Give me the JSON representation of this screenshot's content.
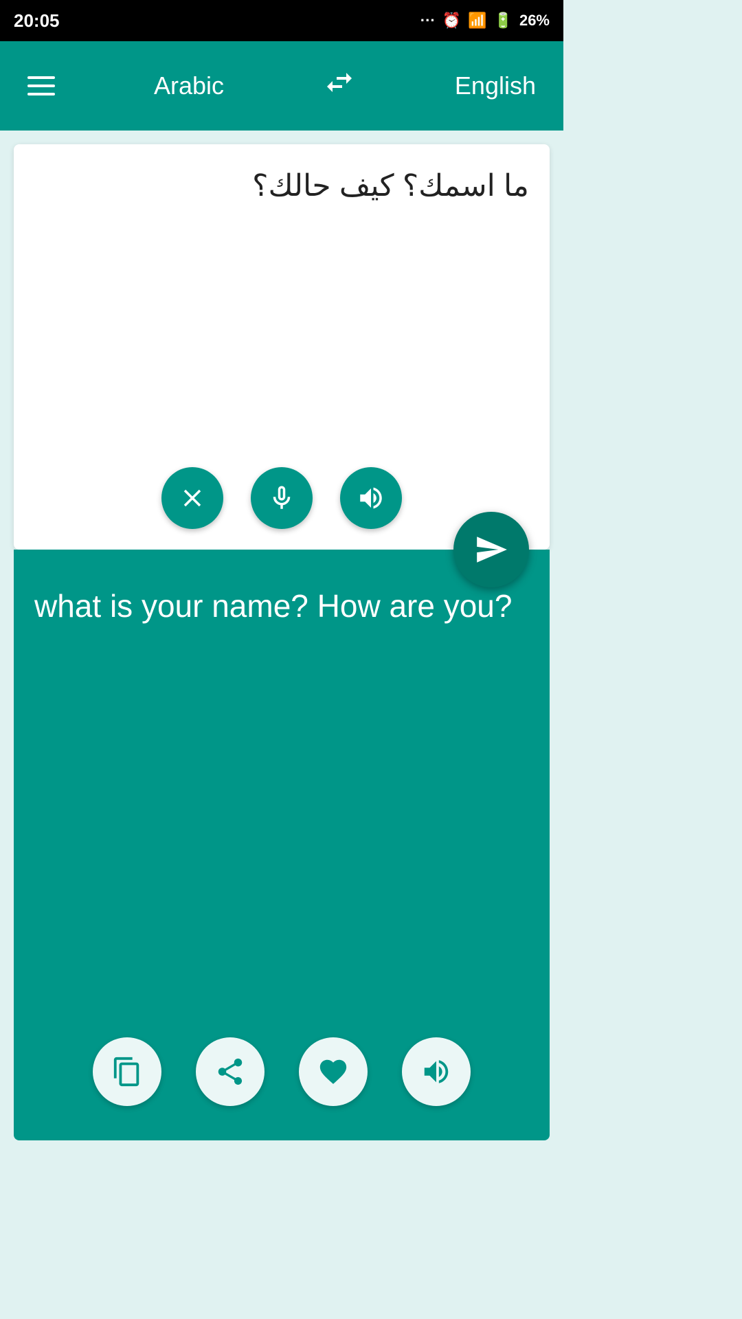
{
  "statusBar": {
    "time": "20:05",
    "battery": "26%"
  },
  "toolbar": {
    "sourceLanguage": "Arabic",
    "targetLanguage": "English",
    "menuIcon": "menu-icon",
    "swapIcon": "swap-icon"
  },
  "sourcePanel": {
    "text": "ما اسمك؟ كيف حالك؟",
    "clearButton": "clear-button",
    "micButton": "microphone-button",
    "speakButton": "speak-source-button"
  },
  "translateButton": {
    "label": "translate-fab"
  },
  "translationPanel": {
    "text": "what is your name? How are you?",
    "copyButton": "copy-button",
    "shareButton": "share-button",
    "favoriteButton": "favorite-button",
    "speakButton": "speak-translation-button"
  },
  "colors": {
    "teal": "#009688",
    "darkTeal": "#00796b",
    "white": "#ffffff"
  }
}
